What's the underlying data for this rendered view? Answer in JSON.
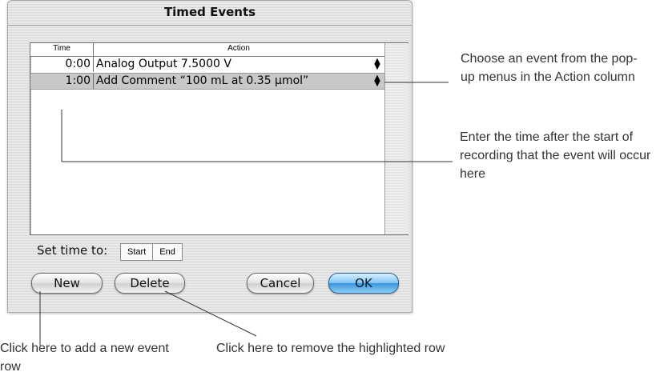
{
  "window": {
    "title": "Timed Events"
  },
  "table": {
    "columns": {
      "time": "Time",
      "action": "Action"
    },
    "rows": [
      {
        "time": "0:00",
        "action": "Analog Output 7.5000 V",
        "selected": false
      },
      {
        "time": "1:00",
        "action": "Add Comment “100 mL at 0.35 µmol”",
        "selected": true
      }
    ],
    "popup_icon": "popup-updown-arrows-icon"
  },
  "set_time": {
    "label": "Set time to:",
    "options": [
      "Start",
      "End"
    ]
  },
  "buttons": {
    "new": "New",
    "delete": "Delete",
    "cancel": "Cancel",
    "ok": "OK"
  },
  "annotations": {
    "action_popup": "Choose an event from the pop-up menus in the Action column",
    "time_entry": "Enter the time after the start of recording that the event will occur here",
    "new_row": "Click here to add a new event row",
    "remove_row": "Click here to remove the highlighted row"
  },
  "colors": {
    "selected_row": "#c8c8c8",
    "default_button": "#3b95dc"
  }
}
